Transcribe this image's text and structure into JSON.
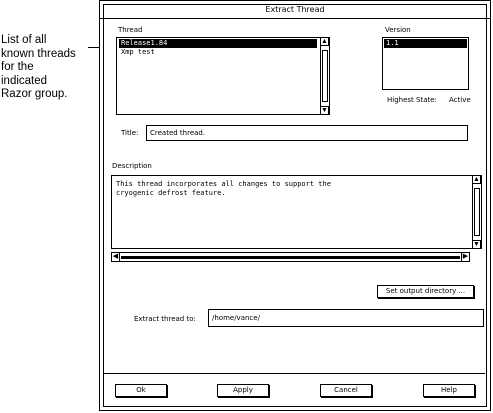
{
  "callout": {
    "lines": [
      "List of all",
      "known threads",
      "for the",
      "indicated",
      "Razor group."
    ]
  },
  "dialog": {
    "title": "Extract Thread",
    "thread": {
      "label": "Thread",
      "items": [
        "Release1.84",
        "Xmp test"
      ]
    },
    "version": {
      "label": "Version",
      "items": [
        "1.1"
      ]
    },
    "highest_state": {
      "label": "Highest State:",
      "value": "Active"
    },
    "title_field": {
      "label": "Title:",
      "value": "Created thread."
    },
    "description": {
      "label": "Description",
      "text": "This thread incorporates all changes to support the\ncryogenic defrost feature."
    },
    "output_dir_button": "Set output directory ...",
    "extract_to": {
      "label": "Extract thread to:",
      "value": "/home/vance/"
    },
    "buttons": {
      "ok": "Ok",
      "apply": "Apply",
      "cancel": "Cancel",
      "help": "Help"
    },
    "icons": {
      "up": "up-arrow-icon",
      "down": "down-arrow-icon",
      "left": "left-arrow-icon",
      "right": "right-arrow-icon"
    }
  }
}
